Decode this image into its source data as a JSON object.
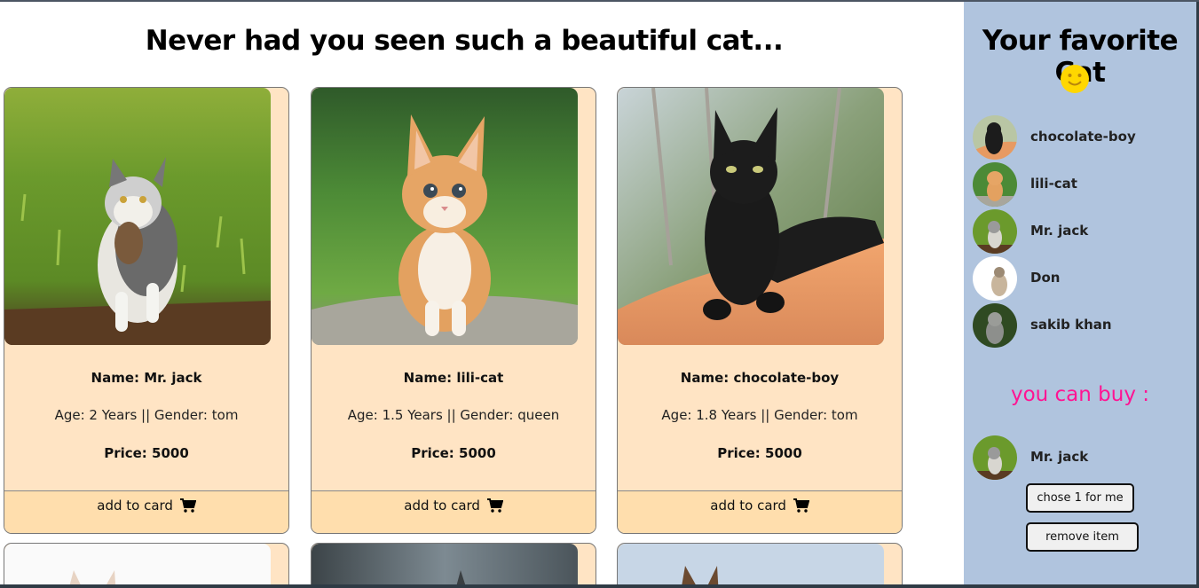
{
  "page": {
    "title": "Never had you seen such a beautiful cat..."
  },
  "cards": [
    {
      "name": "Name: Mr. jack",
      "meta": "Age: 2 Years || Gender: tom",
      "price": "Price: 5000",
      "button": "add to card",
      "photo_icon": "tabby-cat-photo"
    },
    {
      "name": "Name: lili-cat",
      "meta": "Age: 1.5 Years || Gender: queen",
      "price": "Price: 5000",
      "button": "add to card",
      "photo_icon": "orange-kitten-photo"
    },
    {
      "name": "Name: chocolate-boy",
      "meta": "Age: 1.8 Years || Gender: tom",
      "price": "Price: 5000",
      "button": "add to card",
      "photo_icon": "black-cat-photo"
    }
  ],
  "sidebar": {
    "title": "Your favorite Cat",
    "emoji": "smiley-icon",
    "favorites": [
      {
        "label": "chocolate-boy"
      },
      {
        "label": "lili-cat"
      },
      {
        "label": "Mr. jack"
      },
      {
        "label": "Don"
      },
      {
        "label": "sakib khan"
      }
    ],
    "buy_title": "you can buy :",
    "buy_item": {
      "label": "Mr. jack"
    },
    "chose_button": "chose 1 for me",
    "remove_button": "remove item"
  },
  "colors": {
    "card_bg": "#ffe4c4",
    "card_button_bg": "#ffdead",
    "sidebar_bg": "#b0c4de",
    "buy_title": "#ff1493",
    "smiley": "#ffd700"
  }
}
